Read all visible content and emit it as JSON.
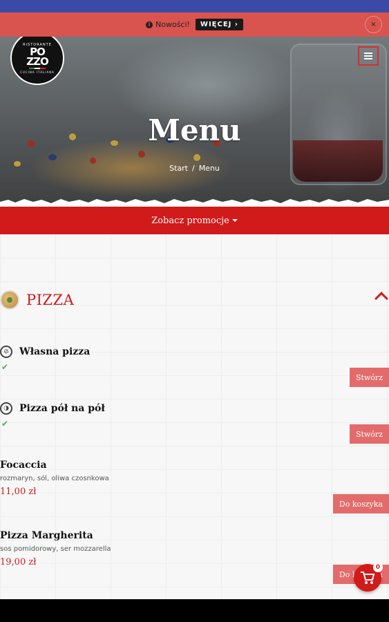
{
  "notice": {
    "text": "Nowości!",
    "more_label": "WIĘCEJ ›",
    "close_label": "×"
  },
  "logo": {
    "top": "RISTORANTE",
    "main_line1": "PO",
    "main_line2": "ZZO",
    "bottom": "CUCINA ITALIANA"
  },
  "hero": {
    "title": "Menu",
    "breadcrumb": [
      "Start",
      "/",
      "Menu"
    ]
  },
  "promo": {
    "label": "Zobacz promocje"
  },
  "category": {
    "title": "PIZZA"
  },
  "items": [
    {
      "name": "Własna pizza",
      "check": "✔",
      "button": "Stwórz"
    },
    {
      "name": "Pizza pół na pół",
      "check": "✔",
      "button": "Stwórz"
    },
    {
      "name": "Focaccia",
      "description": "rozmaryn, sól, oliwa czosnkowa",
      "price": "11,00 zł",
      "button": "Do koszyka"
    },
    {
      "name": "Pizza Margherita",
      "description": "sos pomidorowy, ser mozzarella",
      "price": "19,00 zł",
      "button": "Do koszyka"
    }
  ],
  "cart": {
    "count": "0"
  },
  "colors": {
    "brand_red": "#d11a1a",
    "notice_red": "#d9534f",
    "top_blue": "#3b4aa8",
    "button_red": "#e36b6b"
  }
}
